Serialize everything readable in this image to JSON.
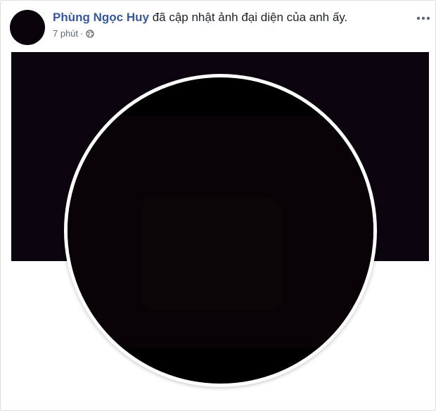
{
  "post": {
    "author_name": "Phùng Ngọc Huy",
    "action_text": "đã cập nhật ảnh đại diện của anh ấy.",
    "timestamp": "7 phút",
    "separator": "·",
    "privacy_icon": "globe-icon",
    "menu_icon": "more-horizontal-icon"
  },
  "colors": {
    "author_link": "#385898",
    "meta_text": "#616770",
    "cover": "#0c040e"
  }
}
